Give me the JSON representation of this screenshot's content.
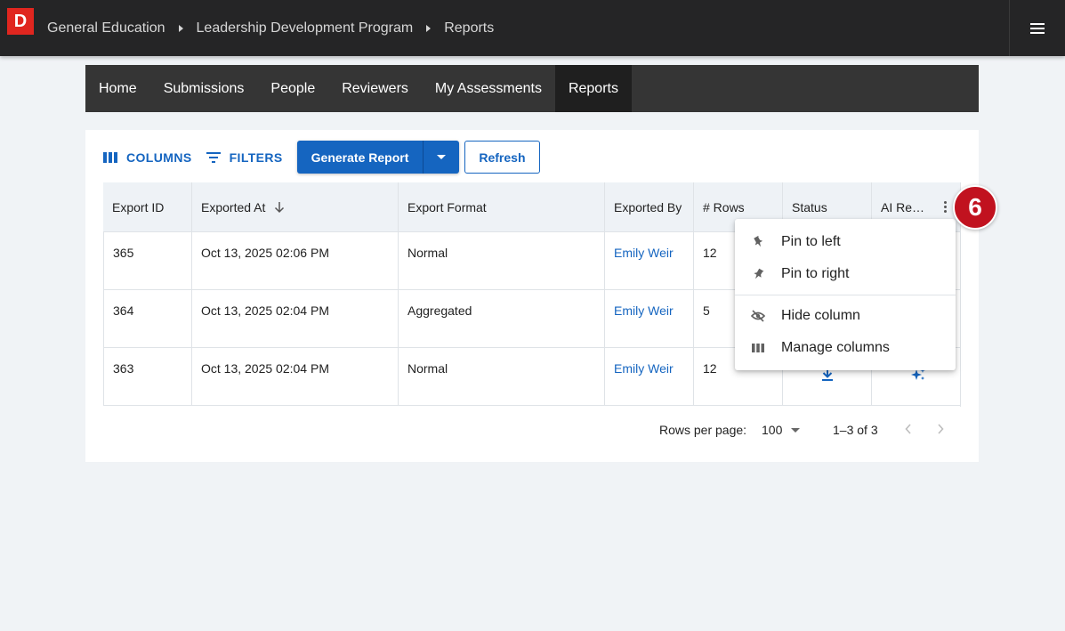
{
  "app": {
    "logo_letter": "D",
    "brand_color": "#e0261f"
  },
  "breadcrumb": [
    "General Education",
    "Leadership Development Program",
    "Reports"
  ],
  "nav": {
    "items": [
      "Home",
      "Submissions",
      "People",
      "Reviewers",
      "My Assessments",
      "Reports"
    ],
    "active": "Reports"
  },
  "toolbar": {
    "columns_label": "COLUMNS",
    "filters_label": "FILTERS",
    "generate_label": "Generate Report",
    "refresh_label": "Refresh"
  },
  "table": {
    "headers": [
      "Export ID",
      "Exported At",
      "Export Format",
      "Exported By",
      "# Rows",
      "Status",
      "AI Re…"
    ],
    "sorted_column": "Exported At",
    "sort_direction": "descending",
    "rows": [
      {
        "id": "365",
        "exported_at": "Oct 13, 2025 02:06 PM",
        "format": "Normal",
        "by": "Emily Weir",
        "rows": "12"
      },
      {
        "id": "364",
        "exported_at": "Oct 13, 2025 02:04 PM",
        "format": "Aggregated",
        "by": "Emily Weir",
        "rows": "5"
      },
      {
        "id": "363",
        "exported_at": "Oct 13, 2025 02:04 PM",
        "format": "Normal",
        "by": "Emily Weir",
        "rows": "12"
      }
    ]
  },
  "pagination": {
    "rows_per_page_label": "Rows per page:",
    "rows_per_page_value": "100",
    "range": "1–3 of 3"
  },
  "column_menu": {
    "items": [
      {
        "label": "Pin to left",
        "icon": "pin-icon"
      },
      {
        "label": "Pin to right",
        "icon": "pin-icon"
      },
      {
        "label": "Hide column",
        "icon": "eye-off-icon"
      },
      {
        "label": "Manage columns",
        "icon": "columns-icon"
      }
    ]
  },
  "step_badge": "6"
}
